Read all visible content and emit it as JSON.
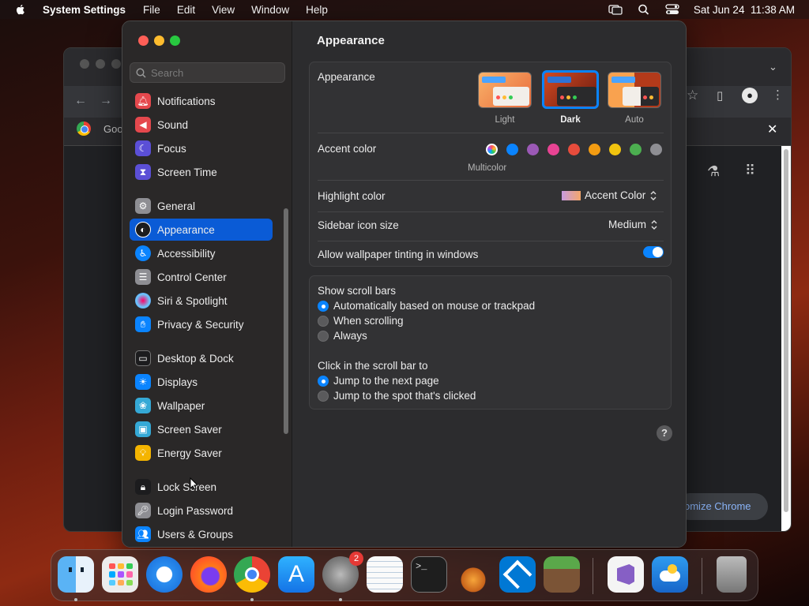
{
  "menubar": {
    "app_name": "System Settings",
    "menus": [
      "File",
      "Edit",
      "View",
      "Window",
      "Help"
    ],
    "datetime": "Sat Jun 24  11:38 AM",
    "icons": [
      "apple-icon",
      "screen-mirroring-icon",
      "search-icon",
      "control-center-icon"
    ]
  },
  "chrome": {
    "tab_title": "Goo",
    "customize_label": "omize Chrome"
  },
  "settings": {
    "search_placeholder": "Search",
    "sidebar": [
      {
        "label": "Notifications",
        "icon": "bell-icon",
        "color": "#e5484d"
      },
      {
        "label": "Sound",
        "icon": "speaker-icon",
        "color": "#e5484d"
      },
      {
        "label": "Focus",
        "icon": "moon-icon",
        "color": "#5b4fd6"
      },
      {
        "label": "Screen Time",
        "icon": "hourglass-icon",
        "color": "#5b4fd6"
      },
      {
        "label": "General",
        "icon": "gear-icon",
        "color": "#8e8e93"
      },
      {
        "label": "Appearance",
        "icon": "appearance-icon",
        "color": "#1c1c1e",
        "selected": true
      },
      {
        "label": "Accessibility",
        "icon": "accessibility-icon",
        "color": "#0a84ff"
      },
      {
        "label": "Control Center",
        "icon": "control-center-icon",
        "color": "#8e8e93"
      },
      {
        "label": "Siri & Spotlight",
        "icon": "siri-icon",
        "color": "#b04fd6"
      },
      {
        "label": "Privacy & Security",
        "icon": "hand-icon",
        "color": "#0a84ff"
      },
      {
        "label": "Desktop & Dock",
        "icon": "dock-icon",
        "color": "#1c1c1e"
      },
      {
        "label": "Displays",
        "icon": "sun-icon",
        "color": "#0a84ff"
      },
      {
        "label": "Wallpaper",
        "icon": "wallpaper-icon",
        "color": "#35a9d6"
      },
      {
        "label": "Screen Saver",
        "icon": "screen-saver-icon",
        "color": "#35a9d6"
      },
      {
        "label": "Energy Saver",
        "icon": "bulb-icon",
        "color": "#f4b400"
      },
      {
        "label": "Lock Screen",
        "icon": "lock-icon",
        "color": "#1c1c1e"
      },
      {
        "label": "Login Password",
        "icon": "key-icon",
        "color": "#8e8e93"
      },
      {
        "label": "Users & Groups",
        "icon": "users-icon",
        "color": "#0a84ff"
      }
    ],
    "main": {
      "title": "Appearance",
      "appearance_label": "Appearance",
      "modes": [
        "Light",
        "Dark",
        "Auto"
      ],
      "selected_mode": "Dark",
      "accent_label": "Accent color",
      "accent_selected_name": "Multicolor",
      "accent_colors": [
        "#0a84ff",
        "#9b59b6",
        "#e84393",
        "#e74c3c",
        "#f39c12",
        "#f1c40f",
        "#4caf50",
        "#8e8e93"
      ],
      "highlight_label": "Highlight color",
      "highlight_value": "Accent Color",
      "sidebar_icon_label": "Sidebar icon size",
      "sidebar_icon_value": "Medium",
      "wallpaper_tint_label": "Allow wallpaper tinting in windows",
      "wallpaper_tint_on": true,
      "scroll_bars_label": "Show scroll bars",
      "scroll_bar_options": [
        "Automatically based on mouse or trackpad",
        "When scrolling",
        "Always"
      ],
      "scroll_bar_selected": 0,
      "click_scroll_label": "Click in the scroll bar to",
      "click_scroll_options": [
        "Jump to the next page",
        "Jump to the spot that's clicked"
      ],
      "click_scroll_selected": 0,
      "help_label": "?"
    }
  },
  "dock": {
    "apps": [
      "Finder",
      "Launchpad",
      "Safari",
      "Firefox",
      "Google Chrome",
      "App Store",
      "System Settings",
      "TextEdit",
      "Terminal",
      "GarageBand",
      "Visual Studio Code",
      "Minecraft",
      "Visual Studio",
      "Weather",
      "Trash"
    ],
    "settings_badge": "2"
  }
}
